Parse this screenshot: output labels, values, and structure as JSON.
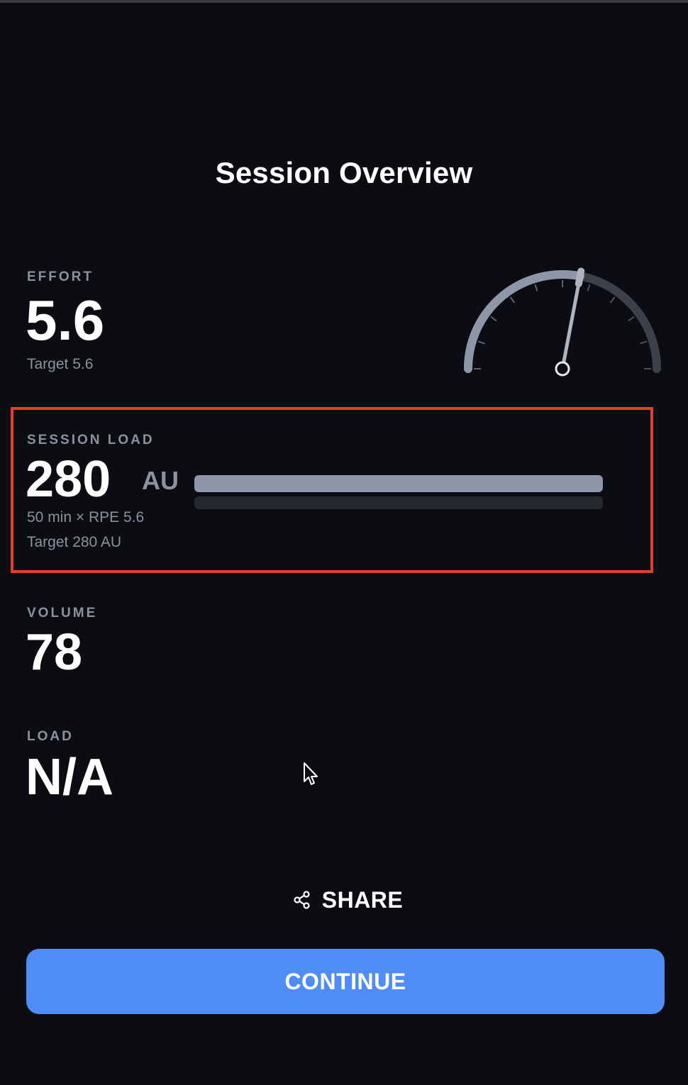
{
  "header": {
    "title": "Session Overview"
  },
  "effort": {
    "label": "EFFORT",
    "value": "5.6",
    "target": "Target 5.6",
    "gauge_level": 5.6,
    "gauge_max": 10
  },
  "session_load": {
    "label": "SESSION LOAD",
    "value": "280",
    "unit": "AU",
    "formula": "50 min × RPE 5.6",
    "target": "Target 280 AU",
    "progress": 1.0
  },
  "volume": {
    "label": "VOLUME",
    "value": "78"
  },
  "load": {
    "label": "LOAD",
    "value": "N/A"
  },
  "actions": {
    "share_label": "SHARE",
    "continue_label": "CONTINUE"
  },
  "icons": {
    "share": "share-icon",
    "cursor": "mouse-cursor-icon"
  },
  "colors": {
    "background": "#0b0d12",
    "accent": "#4f8cf5",
    "highlight": "#e0402a",
    "muted_text": "#8d919b",
    "bar_fill": "#8e97aa"
  }
}
